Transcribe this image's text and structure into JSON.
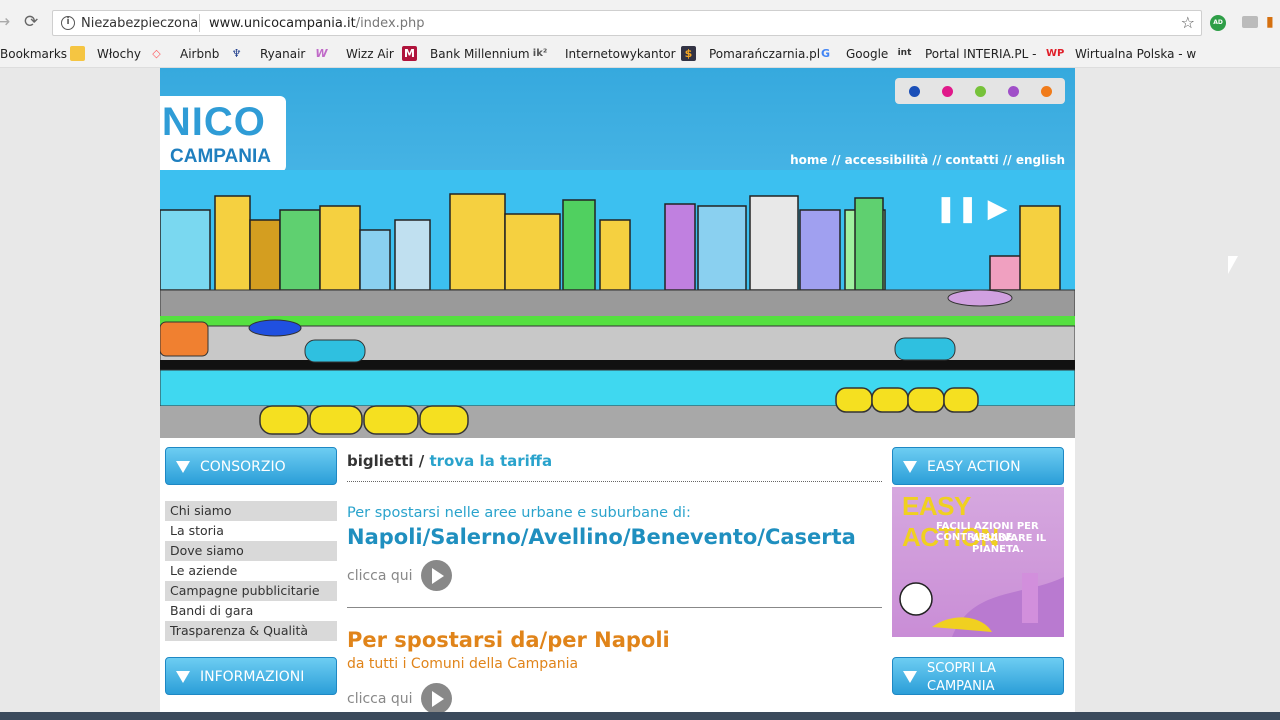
{
  "browser": {
    "security_label": "Niezabezpieczona",
    "url_domain": "www.unicocampania.it",
    "url_path": "/index.php",
    "star_icon": "☆",
    "extension_badge": "AD"
  },
  "bookmarks": [
    {
      "label": "Bookmarks",
      "icon": ""
    },
    {
      "label": "Włochy",
      "icon": "folder-icon"
    },
    {
      "label": "Airbnb",
      "icon": "airbnb-icon"
    },
    {
      "label": "Ryanair",
      "icon": "ryanair-icon"
    },
    {
      "label": "Wizz Air",
      "icon": "wizzair-icon"
    },
    {
      "label": "Bank Millennium",
      "icon": "millennium-icon"
    },
    {
      "label": "Internetowykantor",
      "icon": "ik-icon"
    },
    {
      "label": "Pomarańczarnia.pl",
      "icon": "pomaranczarnia-icon"
    },
    {
      "label": "Google",
      "icon": "google-icon"
    },
    {
      "label": "Portal INTERIA.PL -",
      "icon": "interia-icon"
    },
    {
      "label": "Wirtualna Polska - w",
      "icon": "wp-icon"
    }
  ],
  "site": {
    "logo_top": "UNICO",
    "logo_bottom": "CAMPANIA",
    "colors": [
      "#1b4fb8",
      "#e0198a",
      "#77c23a",
      "#a04fc8",
      "#f07b1a"
    ],
    "topnav": "home // accessibilità // contatti // english",
    "banner_controls": "❚❚ ▶"
  },
  "left": {
    "consorzio": "CONSORZIO",
    "menu": [
      "Chi siamo",
      "La storia",
      "Dove siamo",
      "Le aziende",
      "Campagne pubblicitarie",
      "Bandi di gara",
      "Trasparenza & Qualità"
    ],
    "informazioni": "INFORMAZIONI"
  },
  "main": {
    "crumb_1": "biglietti / ",
    "crumb_2": "trova la tariffa",
    "p1": "Per spostarsi nelle aree urbane e suburbane di:",
    "cities": "Napoli/Salerno/Avellino/Benevento/Caserta",
    "clicca_1": "clicca qui",
    "napoli_title": "Per spostarsi da/per Napoli",
    "napoli_sub": "da tutti i Comuni della Campania",
    "clicca_2": "clicca qui"
  },
  "right": {
    "easy_action": "EASY ACTION",
    "easy_img_title": "EASY ACTION",
    "easy_img_sub1": "FACILI AZIONI PER CONTRIBUIRE",
    "easy_img_sub2": "A SALVARE IL PIANETA.",
    "scopri": "SCOPRI LA CAMPANIA"
  }
}
